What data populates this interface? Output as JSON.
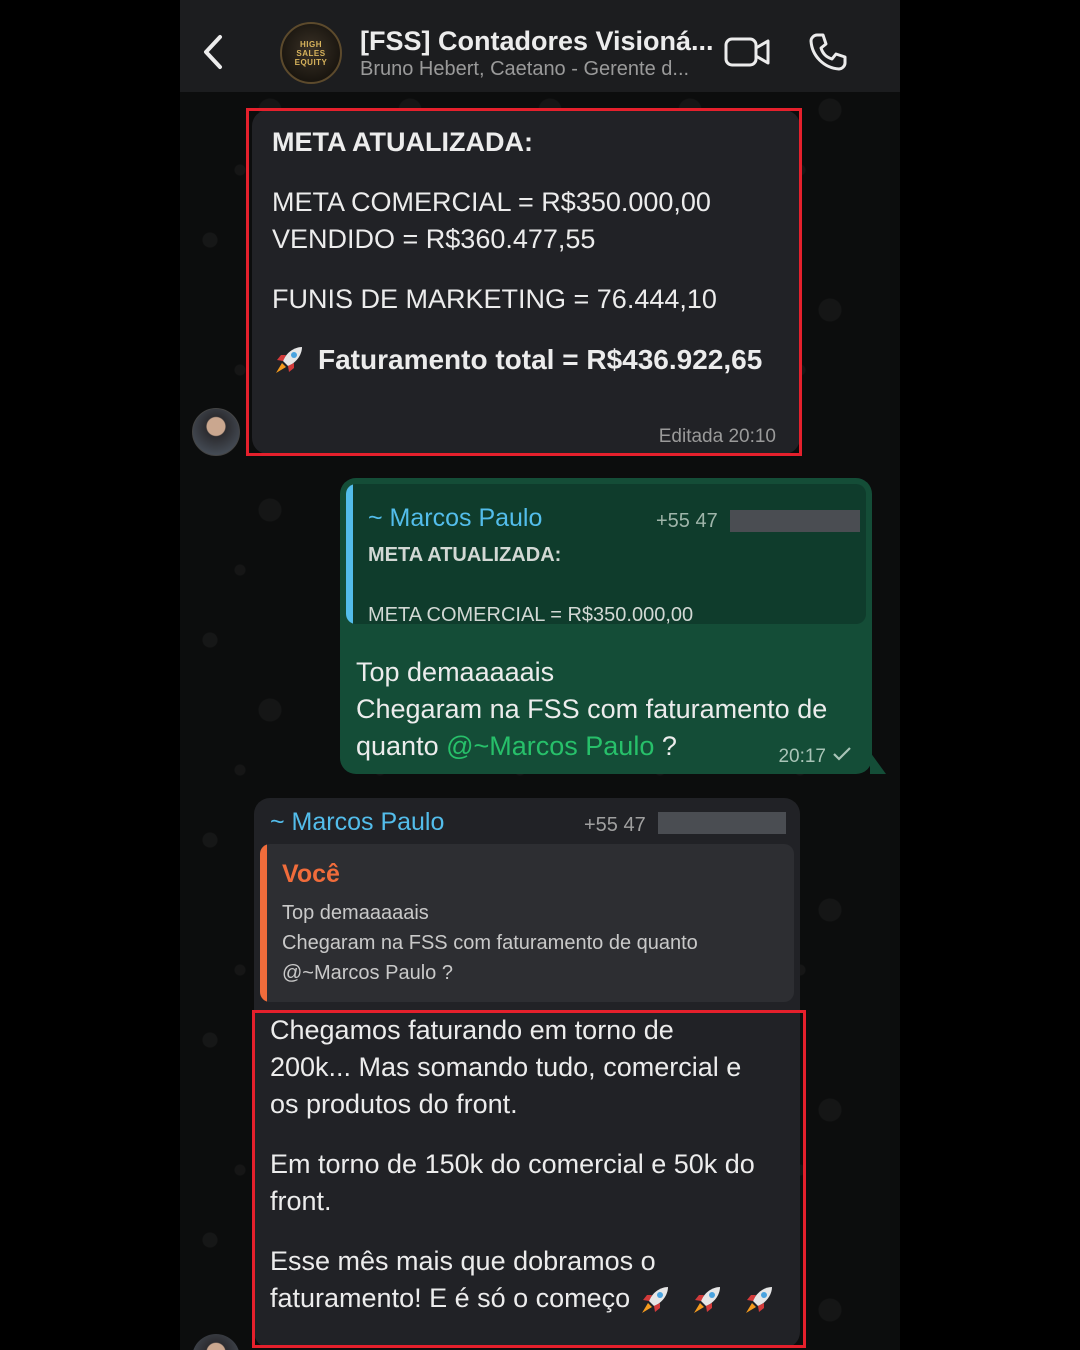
{
  "header": {
    "title": "[FSS] Contadores Visioná...",
    "subtitle": "Bruno Hebert, Caetano - Gerente d...",
    "avatar_text": [
      "HIGH",
      "SALES",
      "EQUITY"
    ]
  },
  "message1": {
    "title": "META ATUALIZADA:",
    "meta_comercial": "META COMERCIAL = R$350.000,00",
    "vendido": "VENDIDO = R$360.477,55",
    "funis": "FUNIS DE MARKETING = 76.444,10",
    "faturamento": "Faturamento total = R$436.922,65",
    "status": "Editada 20:10"
  },
  "message2": {
    "quote_author": "~ Marcos Paulo",
    "quote_phone": "+55 47",
    "quote_line1": "META ATUALIZADA:",
    "quote_line2": "META COMERCIAL = R$350.000,00",
    "line1": "Top demaaaaais",
    "line2": "Chegaram na FSS com faturamento de",
    "line3_prefix": "quanto ",
    "mention": "@~Marcos Paulo",
    "line3_suffix": " ?",
    "time": "20:17"
  },
  "message3": {
    "sender": "~ Marcos Paulo",
    "sender_phone": "+55 47",
    "quote_author": "Você",
    "quote_line1": "Top demaaaaais",
    "quote_line2": "Chegaram na FSS com faturamento de quanto",
    "quote_line3": "@~Marcos Paulo ?",
    "p1_l1": "Chegamos faturando em torno de",
    "p1_l2": "200k... Mas somando tudo, comercial e",
    "p1_l3": "os produtos do front.",
    "p2_l1": "Em torno de 150k do comercial e 50k do",
    "p2_l2": "front.",
    "p3_l1": "Esse mês mais que dobramos o",
    "p3_l2": "faturamento! E é só o começo"
  },
  "colors": {
    "background": "#0c0d0d",
    "incoming_bubble": "#212226",
    "outgoing_bubble": "#144d37",
    "mention": "#27c06a",
    "quote_bar_blue": "#53bdeb",
    "quote_bar_orange": "#f06c3b",
    "highlight_border": "#e5202c"
  }
}
